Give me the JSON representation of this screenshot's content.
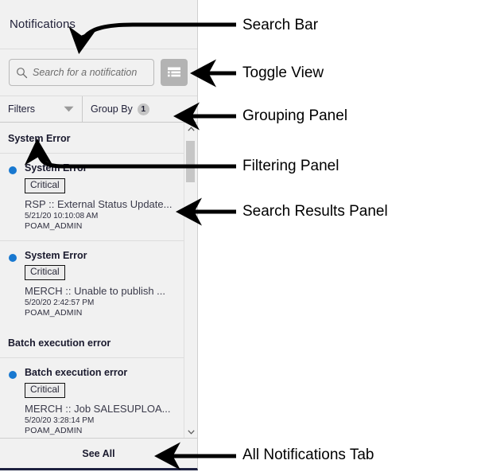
{
  "panel": {
    "title": "Notifications",
    "search": {
      "icon": "search-icon",
      "placeholder": "Search for a notification",
      "value": ""
    },
    "toggle_view": {
      "icon": "list-view-icon",
      "tooltip": "Toggle View"
    },
    "filter_bar": {
      "filters_label": "Filters",
      "filters_caret_icon": "chevron-down-icon",
      "groupby_label": "Group By",
      "groupby_count": "1"
    },
    "groups": [
      {
        "header": "System Error",
        "items": [
          {
            "title": "System Error",
            "severity": "Critical",
            "message": "RSP :: External Status Update...",
            "timestamp": "5/21/20 10:10:08 AM",
            "user": "POAM_ADMIN",
            "unread": true
          },
          {
            "title": "System Error",
            "severity": "Critical",
            "message": "MERCH :: Unable to publish ...",
            "timestamp": "5/20/20 2:42:57 PM",
            "user": "POAM_ADMIN",
            "unread": true
          }
        ]
      },
      {
        "header": "Batch execution error",
        "items": [
          {
            "title": "Batch execution error",
            "severity": "Critical",
            "message": "MERCH :: Job SALESUPLOA...",
            "timestamp": "5/20/20 3:28:14 PM",
            "user": "POAM_ADMIN",
            "unread": true
          }
        ]
      }
    ],
    "scrollbar": {
      "up_icon": "chevron-up-icon",
      "down_icon": "chevron-down-icon"
    },
    "footer": {
      "see_all_label": "See All"
    }
  },
  "annotations": [
    {
      "label": "Search Bar",
      "target": "search-box"
    },
    {
      "label": "Toggle View",
      "target": "toggle-view-button"
    },
    {
      "label": "Grouping Panel",
      "target": "groupby-tab"
    },
    {
      "label": "Filtering Panel",
      "target": "filters-tab"
    },
    {
      "label": "Search Results Panel",
      "target": "results-list"
    },
    {
      "label": "All Notifications Tab",
      "target": "see-all-button"
    }
  ],
  "colors": {
    "accent_blue": "#1878d0",
    "panel_bg": "#f1f1f1",
    "toggle_bg": "#b3b3b3",
    "badge_bg": "#c4c4c4",
    "footer_rule": "#1d2040"
  }
}
